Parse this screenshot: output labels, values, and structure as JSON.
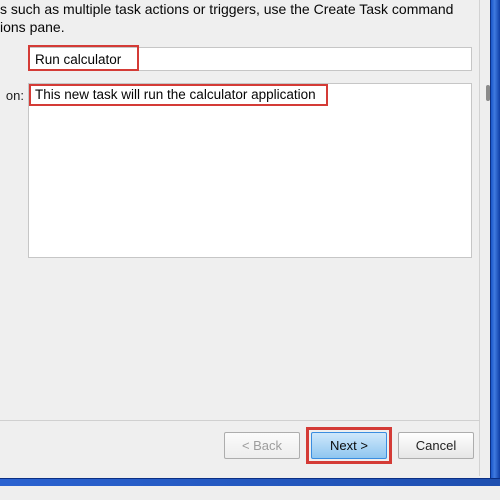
{
  "instruction": "s such as multiple task actions or triggers, use the Create Task command\nions pane.",
  "labels": {
    "description_suffix": "on:"
  },
  "fields": {
    "name_value": "Run calculator",
    "description_value": "This new task will run the calculator application"
  },
  "buttons": {
    "back": "< Back",
    "next": "Next >",
    "cancel": "Cancel"
  },
  "highlights": {
    "color": "#d43b36",
    "name": true,
    "description": true,
    "next": true
  }
}
